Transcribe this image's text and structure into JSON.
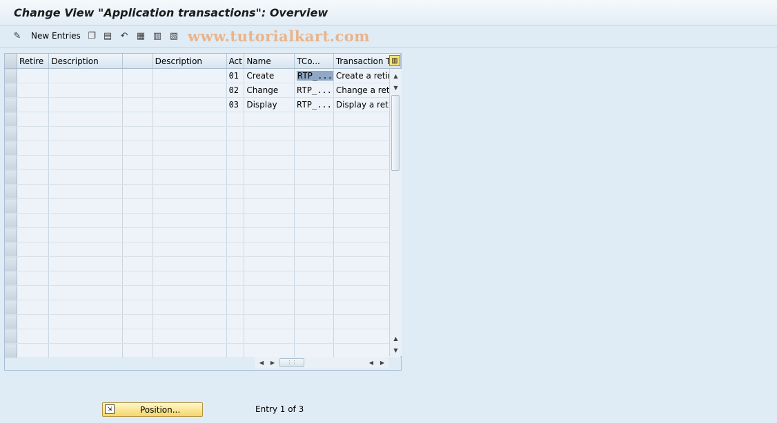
{
  "window": {
    "title": "Change View \"Application transactions\": Overview"
  },
  "toolbar": {
    "new_entries_label": "New Entries",
    "icons": [
      "pencil-glasses-icon",
      "copy-icon",
      "delete-icon",
      "undo-icon",
      "select-all-icon",
      "select-block-icon",
      "deselect-all-icon"
    ],
    "watermark": "www.tutorialkart.com"
  },
  "table": {
    "columns": [
      "Retire",
      "Description",
      "",
      "Description",
      "Act",
      "Name",
      "TCo...",
      "Transaction Te"
    ],
    "rows": [
      [
        "",
        "",
        "",
        "",
        "01",
        "Create",
        "RTP_...",
        "Create a retire"
      ],
      [
        "",
        "",
        "",
        "",
        "02",
        "Change",
        "RTP_...",
        "Change a retire"
      ],
      [
        "",
        "",
        "",
        "",
        "03",
        "Display",
        "RTP_...",
        "Display a retire"
      ]
    ]
  },
  "footer": {
    "position_button_label": "Position...",
    "entry_text": "Entry 1 of 3"
  }
}
